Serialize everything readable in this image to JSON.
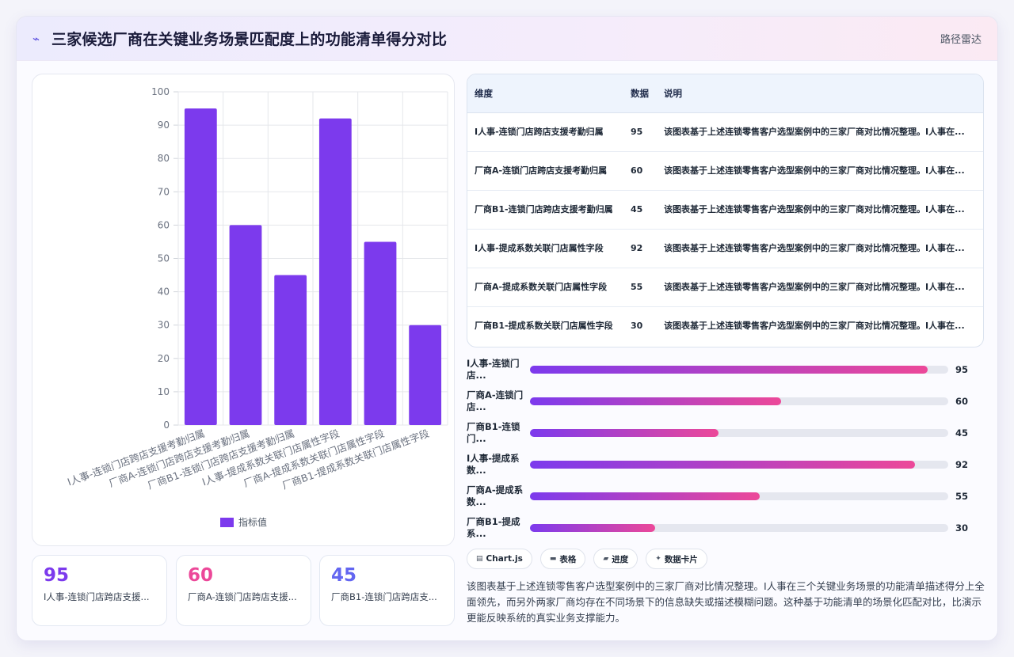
{
  "header": {
    "icon": "line-chart-icon",
    "title": "三家候选厂商在关键业务场景匹配度上的功能清单得分对比",
    "tag": "路径雷达"
  },
  "colors": {
    "bar": "#7c3aed",
    "accent_pink": "#ec4899",
    "accent_blue": "#6366f1",
    "stat_colors": [
      "#7c3aed",
      "#ec4899",
      "#6366f1"
    ]
  },
  "chart_data": {
    "type": "bar",
    "categories": [
      "I人事-连锁门店跨店支援考勤归属",
      "厂商A-连锁门店跨店支援考勤归属",
      "厂商B1-连锁门店跨店支援考勤归属",
      "I人事-提成系数关联门店属性字段",
      "厂商A-提成系数关联门店属性字段",
      "厂商B1-提成系数关联门店属性字段"
    ],
    "series": [
      {
        "name": "指标值",
        "values": [
          95,
          60,
          45,
          92,
          55,
          30
        ]
      }
    ],
    "ylim": [
      0,
      100
    ],
    "yticks": [
      0,
      10,
      20,
      30,
      40,
      50,
      60,
      70,
      80,
      90,
      100
    ],
    "grid": true,
    "legend": "bottom"
  },
  "stats": [
    {
      "value": "95",
      "label": "I人事-连锁门店跨店支援..."
    },
    {
      "value": "60",
      "label": "厂商A-连锁门店跨店支援..."
    },
    {
      "value": "45",
      "label": "厂商B1-连锁门店跨店支..."
    }
  ],
  "table": {
    "headers": [
      "维度",
      "数据",
      "说明"
    ],
    "rows": [
      {
        "dim": "I人事-连锁门店跨店支援考勤归属",
        "val": "95",
        "desc": "该图表基于上述连锁零售客户选型案例中的三家厂商对比情况整理。I人事在..."
      },
      {
        "dim": "厂商A-连锁门店跨店支援考勤归属",
        "val": "60",
        "desc": "该图表基于上述连锁零售客户选型案例中的三家厂商对比情况整理。I人事在..."
      },
      {
        "dim": "厂商B1-连锁门店跨店支援考勤归属",
        "val": "45",
        "desc": "该图表基于上述连锁零售客户选型案例中的三家厂商对比情况整理。I人事在..."
      },
      {
        "dim": "I人事-提成系数关联门店属性字段",
        "val": "92",
        "desc": "该图表基于上述连锁零售客户选型案例中的三家厂商对比情况整理。I人事在..."
      },
      {
        "dim": "厂商A-提成系数关联门店属性字段",
        "val": "55",
        "desc": "该图表基于上述连锁零售客户选型案例中的三家厂商对比情况整理。I人事在..."
      },
      {
        "dim": "厂商B1-提成系数关联门店属性字段",
        "val": "30",
        "desc": "该图表基于上述连锁零售客户选型案例中的三家厂商对比情况整理。I人事在..."
      }
    ]
  },
  "progress": [
    {
      "label": "I人事-连锁门店...",
      "value": 95,
      "display": "95"
    },
    {
      "label": "厂商A-连锁门店...",
      "value": 60,
      "display": "60"
    },
    {
      "label": "厂商B1-连锁门...",
      "value": 45,
      "display": "45"
    },
    {
      "label": "I人事-提成系数...",
      "value": 92,
      "display": "92"
    },
    {
      "label": "厂商A-提成系数...",
      "value": 55,
      "display": "55"
    },
    {
      "label": "厂商B1-提成系...",
      "value": 30,
      "display": "30"
    }
  ],
  "chips": [
    {
      "icon": "chart-icon",
      "glyph": "▤",
      "label": "Chart.js"
    },
    {
      "icon": "table-icon",
      "glyph": "▬",
      "label": "表格"
    },
    {
      "icon": "progress-icon",
      "glyph": "▰",
      "label": "进度"
    },
    {
      "icon": "sparkle-icon",
      "glyph": "✦",
      "label": "数据卡片"
    }
  ],
  "description": "该图表基于上述连锁零售客户选型案例中的三家厂商对比情况整理。I人事在三个关键业务场景的功能清单描述得分上全面领先，而另外两家厂商均存在不同场景下的信息缺失或描述模糊问题。这种基于功能清单的场景化匹配对比，比演示更能反映系统的真实业务支撑能力。"
}
